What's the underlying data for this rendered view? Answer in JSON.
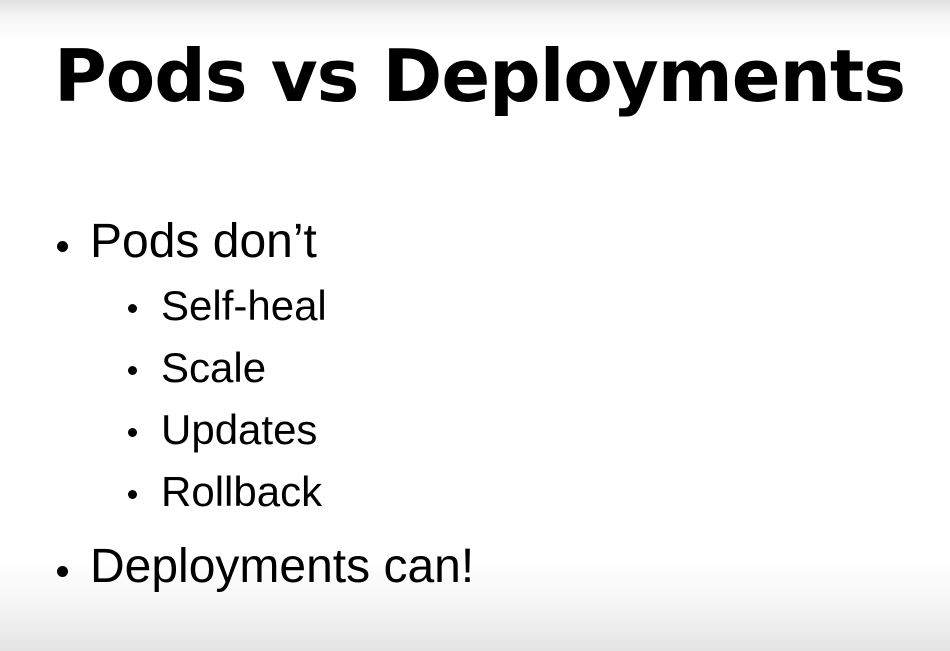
{
  "slide": {
    "title": "Pods vs Deployments",
    "bullets": [
      {
        "text": "Pods don’t",
        "children": [
          "Self-heal",
          "Scale",
          "Updates",
          "Rollback"
        ]
      },
      {
        "text": "Deployments can!",
        "children": []
      }
    ]
  }
}
